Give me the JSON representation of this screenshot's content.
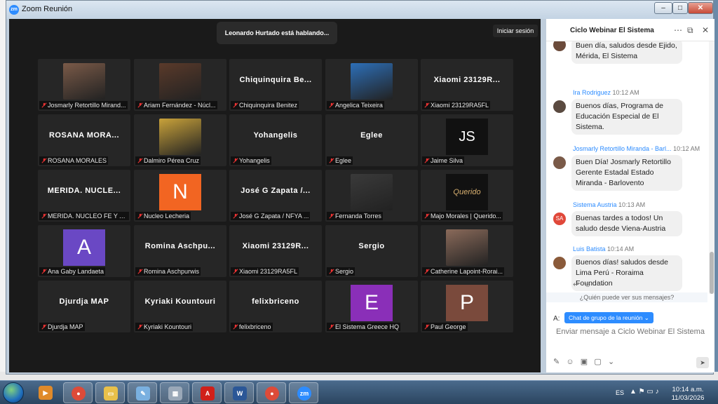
{
  "window": {
    "title": "Zoom Reunión",
    "min": "–",
    "max": "□",
    "close": "✕"
  },
  "banner": {
    "speaking": "Leonardo Hurtado está hablando...",
    "signin": "Iniciar sesión"
  },
  "tiles": [
    {
      "name": "",
      "label": "Josmarly Retortillo Mirand...",
      "kind": "photo",
      "bg": "#7a5a48"
    },
    {
      "name": "",
      "label": "Ariam Fernández - Núcl...",
      "kind": "photo",
      "bg": "#5a3a2a"
    },
    {
      "name": "Chiquinquira  Be...",
      "label": "Chiquinquira Benitez",
      "kind": "text"
    },
    {
      "name": "",
      "label": "Angelica Teixeira",
      "kind": "photo",
      "bg": "#2d6fb8"
    },
    {
      "name": "Xiaomi  23129R...",
      "label": "Xiaomi 23129RA5FL",
      "kind": "text"
    },
    {
      "name": "ROSANA  MORA...",
      "label": "ROSANA MORALES",
      "kind": "text"
    },
    {
      "name": "",
      "label": "Dalmiro Pérea Cruz",
      "kind": "photo",
      "bg": "#c9a23a"
    },
    {
      "name": "Yohangelis",
      "label": "Yohangelis",
      "kind": "text"
    },
    {
      "name": "Eglee",
      "label": "Eglee",
      "kind": "text"
    },
    {
      "name": "",
      "label": "Jaime Silva",
      "kind": "letter",
      "letter": "JS",
      "bg": "#111111"
    },
    {
      "name": "MERIDA.  NUCLE...",
      "label": "MERIDA. NUCLEO FE Y ALE...",
      "kind": "text"
    },
    {
      "name": "",
      "label": "Nucleo Lecheria",
      "kind": "letter",
      "letter": "N",
      "bg": "#f26522"
    },
    {
      "name": "José  G Zapata  /...",
      "label": "José G Zapata / NFYA ...",
      "kind": "text"
    },
    {
      "name": "",
      "label": "Fernanda Torres",
      "kind": "photo",
      "bg": "#3a3a3a"
    },
    {
      "name": "",
      "label": "Majo Morales | Querido...",
      "kind": "logo",
      "letter": "Querido Arte",
      "bg": "#111111"
    },
    {
      "name": "",
      "label": "Ana Gaby Landaeta",
      "kind": "letter",
      "letter": "A",
      "bg": "#6a48c4"
    },
    {
      "name": "Romina  Aschpu...",
      "label": "Romina Aschpurwis",
      "kind": "text"
    },
    {
      "name": "Xiaomi  23129R...",
      "label": "Xiaomi 23129RA5FL",
      "kind": "text"
    },
    {
      "name": "Sergio",
      "label": "Sergio",
      "kind": "text"
    },
    {
      "name": "",
      "label": "Catherine Lapoint-Rorai...",
      "kind": "photo",
      "bg": "#8a6a5a"
    },
    {
      "name": "Djurdja  MAP",
      "label": "Djurdja MAP",
      "kind": "text"
    },
    {
      "name": "Kyriaki  Kountouri",
      "label": "Kyriaki Kountouri",
      "kind": "text"
    },
    {
      "name": "felixbriceno",
      "label": "felixbriceno",
      "kind": "text"
    },
    {
      "name": "",
      "label": "El Sistema Greece HQ",
      "kind": "letter",
      "letter": "E",
      "bg": "#8a2fb8"
    },
    {
      "name": "",
      "label": "Paul George",
      "kind": "letter",
      "letter": "P",
      "bg": "#7a4a3c"
    }
  ],
  "chat": {
    "title": "Ciclo Webinar El Sistema",
    "messages": [
      {
        "sender": "",
        "time": "",
        "text": "Buen día, saludos desde Ejido, Mérida, El Sistema",
        "avatar": "#6a4a3a"
      },
      {
        "sender": "Ira Rodriguez",
        "time": "10:12 AM",
        "text": "Buenos días, Programa de Educación Especial de El Sistema.",
        "avatar": "#5a4a40"
      },
      {
        "sender": "Josmarly Retortillo Miranda - Barl...",
        "time": "10:12 AM",
        "text": "Buen Día! Josmarly Retortillo Gerente Estadal Estado Miranda - Barlovento",
        "avatar": "#7a5a48"
      },
      {
        "sender": "Sistema Austria",
        "time": "10:13 AM",
        "text": "Buenas tardes a todos! Un saludo desde Viena-Austria",
        "avatar": "#e0483a",
        "initials": "SA"
      },
      {
        "sender": "Luis Batista",
        "time": "10:14 AM",
        "text": "Buenos días! saludos desde Lima Perú - Roraima Foundation",
        "avatar": "#8a5a3a"
      }
    ],
    "who_can_see": "¿Quién puede ver sus mensajes?",
    "to_label": "A:",
    "to_value": "Chat de grupo de la reunión ⌄",
    "input_placeholder": "Enviar mensaje a Ciclo Webinar El Sistema"
  },
  "taskbar": {
    "apps": [
      {
        "icon": "media-player-icon",
        "color": "#e08a2a",
        "glyph": "▶"
      },
      {
        "icon": "chrome-icon",
        "color": "#dd4b39",
        "glyph": "●"
      },
      {
        "icon": "folder-icon",
        "color": "#e8c04a",
        "glyph": "▭"
      },
      {
        "icon": "paint-icon",
        "color": "#7ab0e0",
        "glyph": "✎"
      },
      {
        "icon": "calculator-icon",
        "color": "#9aa8b8",
        "glyph": "▦"
      },
      {
        "icon": "acrobat-icon",
        "color": "#d0201a",
        "glyph": "A"
      },
      {
        "icon": "word-icon",
        "color": "#2b5797",
        "glyph": "W"
      },
      {
        "icon": "chrome-icon",
        "color": "#dd4b39",
        "glyph": "●"
      },
      {
        "icon": "zoom-icon",
        "color": "#2d8cff",
        "glyph": "zm"
      }
    ],
    "lang": "ES",
    "time": "10:14 a.m.",
    "date": "11/03/2026"
  }
}
